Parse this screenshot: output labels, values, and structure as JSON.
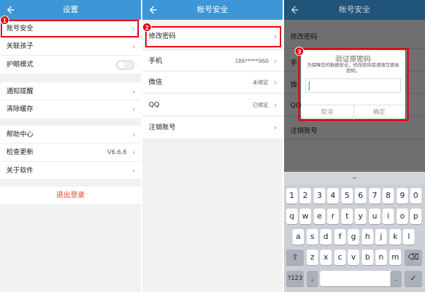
{
  "panel1": {
    "title": "设置",
    "badge": "1",
    "items": [
      {
        "label": "账号安全"
      },
      {
        "label": "关联孩子"
      },
      {
        "label": "护眼模式"
      },
      {
        "label": "通知提醒"
      },
      {
        "label": "清除缓存"
      },
      {
        "label": "帮助中心"
      },
      {
        "label": "检查更新",
        "value": "V6.6.6"
      },
      {
        "label": "关于软件"
      }
    ],
    "logout": "退出登录",
    "eye_mode_on": false
  },
  "panel2": {
    "title": "帐号安全",
    "badge": "2",
    "items": [
      {
        "label": "修改密码",
        "value": ""
      },
      {
        "label": "手机",
        "value": "186*****960"
      },
      {
        "label": "微信",
        "value": "未绑定"
      },
      {
        "label": "QQ",
        "value": "已绑定"
      },
      {
        "label": "注销账号",
        "value": ""
      }
    ]
  },
  "panel3": {
    "title": "帐号安全",
    "badge": "3",
    "background_items": [
      "修改密码",
      "手",
      "微",
      "QQ",
      "注销账号"
    ],
    "dialog": {
      "title": "验证原密码",
      "message": "为保障您的数据安全，修改密码前请填写原始密码。",
      "input_value": "",
      "cancel": "取消",
      "confirm": "确定"
    },
    "keyboard": {
      "collapse": "⌄",
      "row1": [
        "1",
        "2",
        "3",
        "4",
        "5",
        "6",
        "7",
        "8",
        "9",
        "0"
      ],
      "row2": [
        "q",
        "w",
        "e",
        "r",
        "t",
        "y",
        "u",
        "i",
        "o",
        "p"
      ],
      "row3": [
        "a",
        "s",
        "d",
        "f",
        "g",
        "h",
        "j",
        "k",
        "l"
      ],
      "row4": [
        "z",
        "x",
        "c",
        "v",
        "b",
        "n",
        "m"
      ],
      "shift": "⇧",
      "backspace": "⌫",
      "symbols": "?123",
      "comma": ",",
      "period": ".",
      "enter": "✓"
    }
  },
  "colors": {
    "header": "#3d96d6",
    "highlight": "#e60012",
    "logout": "#e2472d"
  }
}
